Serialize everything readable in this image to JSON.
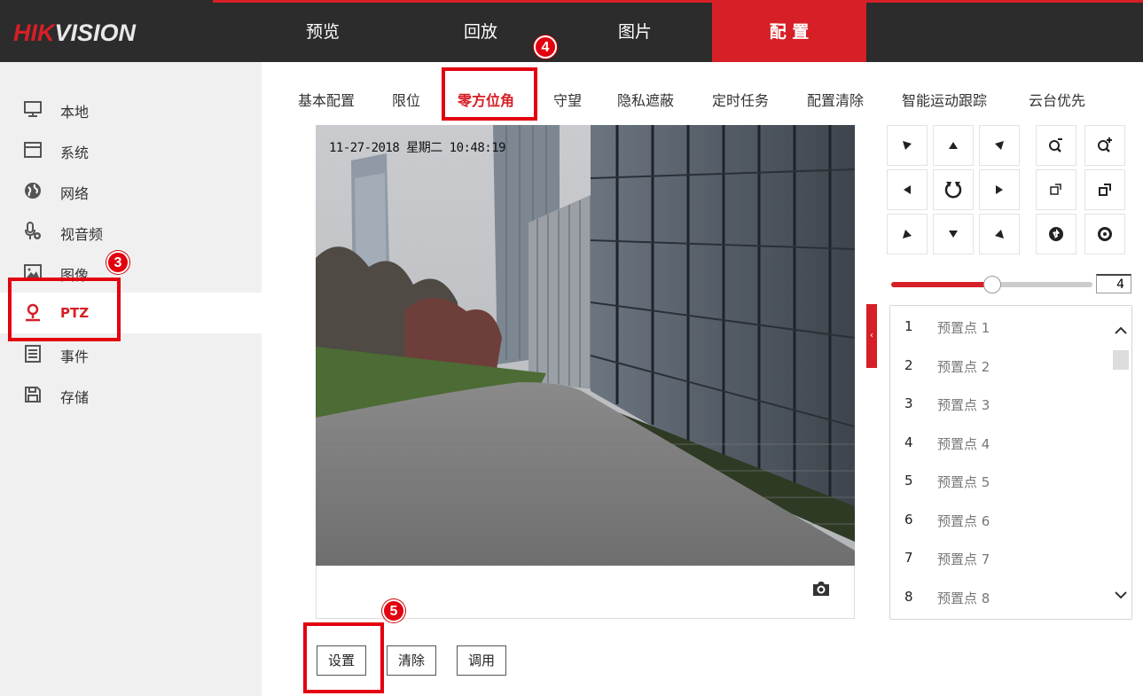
{
  "brand": {
    "logo_red": "HIK",
    "logo_white": "VISION"
  },
  "topnav": {
    "items": [
      {
        "label": "预览"
      },
      {
        "label": "回放"
      },
      {
        "label": "图片"
      },
      {
        "label": "配 置",
        "active": true
      }
    ]
  },
  "sidebar": {
    "items": [
      {
        "label": "本地",
        "icon": "monitor-icon"
      },
      {
        "label": "系统",
        "icon": "window-icon"
      },
      {
        "label": "网络",
        "icon": "globe-icon"
      },
      {
        "label": "视音频",
        "icon": "microphone-icon"
      },
      {
        "label": "图像",
        "icon": "image-icon"
      },
      {
        "label": "PTZ",
        "icon": "ptz-user-icon",
        "active": true
      },
      {
        "label": "事件",
        "icon": "event-list-icon"
      },
      {
        "label": "存储",
        "icon": "save-disk-icon"
      }
    ]
  },
  "subtabs": {
    "items": [
      {
        "label": "基本配置"
      },
      {
        "label": "限位"
      },
      {
        "label": "零方位角",
        "active": true
      },
      {
        "label": "守望"
      },
      {
        "label": "隐私遮蔽"
      },
      {
        "label": "定时任务"
      },
      {
        "label": "配置清除"
      },
      {
        "label": "智能运动跟踪"
      },
      {
        "label": "云台优先"
      }
    ]
  },
  "video": {
    "osd_text": "11-27-2018 星期二 10:48:19"
  },
  "ptz": {
    "speed_value": "4",
    "speed_fraction": 0.5
  },
  "presets": {
    "items": [
      {
        "num": "1",
        "name": "预置点 1"
      },
      {
        "num": "2",
        "name": "预置点 2"
      },
      {
        "num": "3",
        "name": "预置点 3"
      },
      {
        "num": "4",
        "name": "预置点 4"
      },
      {
        "num": "5",
        "name": "预置点 5"
      },
      {
        "num": "6",
        "name": "预置点 6"
      },
      {
        "num": "7",
        "name": "预置点 7"
      },
      {
        "num": "8",
        "name": "预置点 8"
      }
    ]
  },
  "actions": {
    "set_label": "设置",
    "clear_label": "清除",
    "call_label": "调用"
  },
  "annotations": {
    "badge_3": "3",
    "badge_4": "4",
    "badge_5": "5"
  },
  "colors": {
    "accent": "#d61f26",
    "annotation": "#e3000f",
    "topbar": "#2c2c2c",
    "sidebar": "#f0f0f0"
  }
}
